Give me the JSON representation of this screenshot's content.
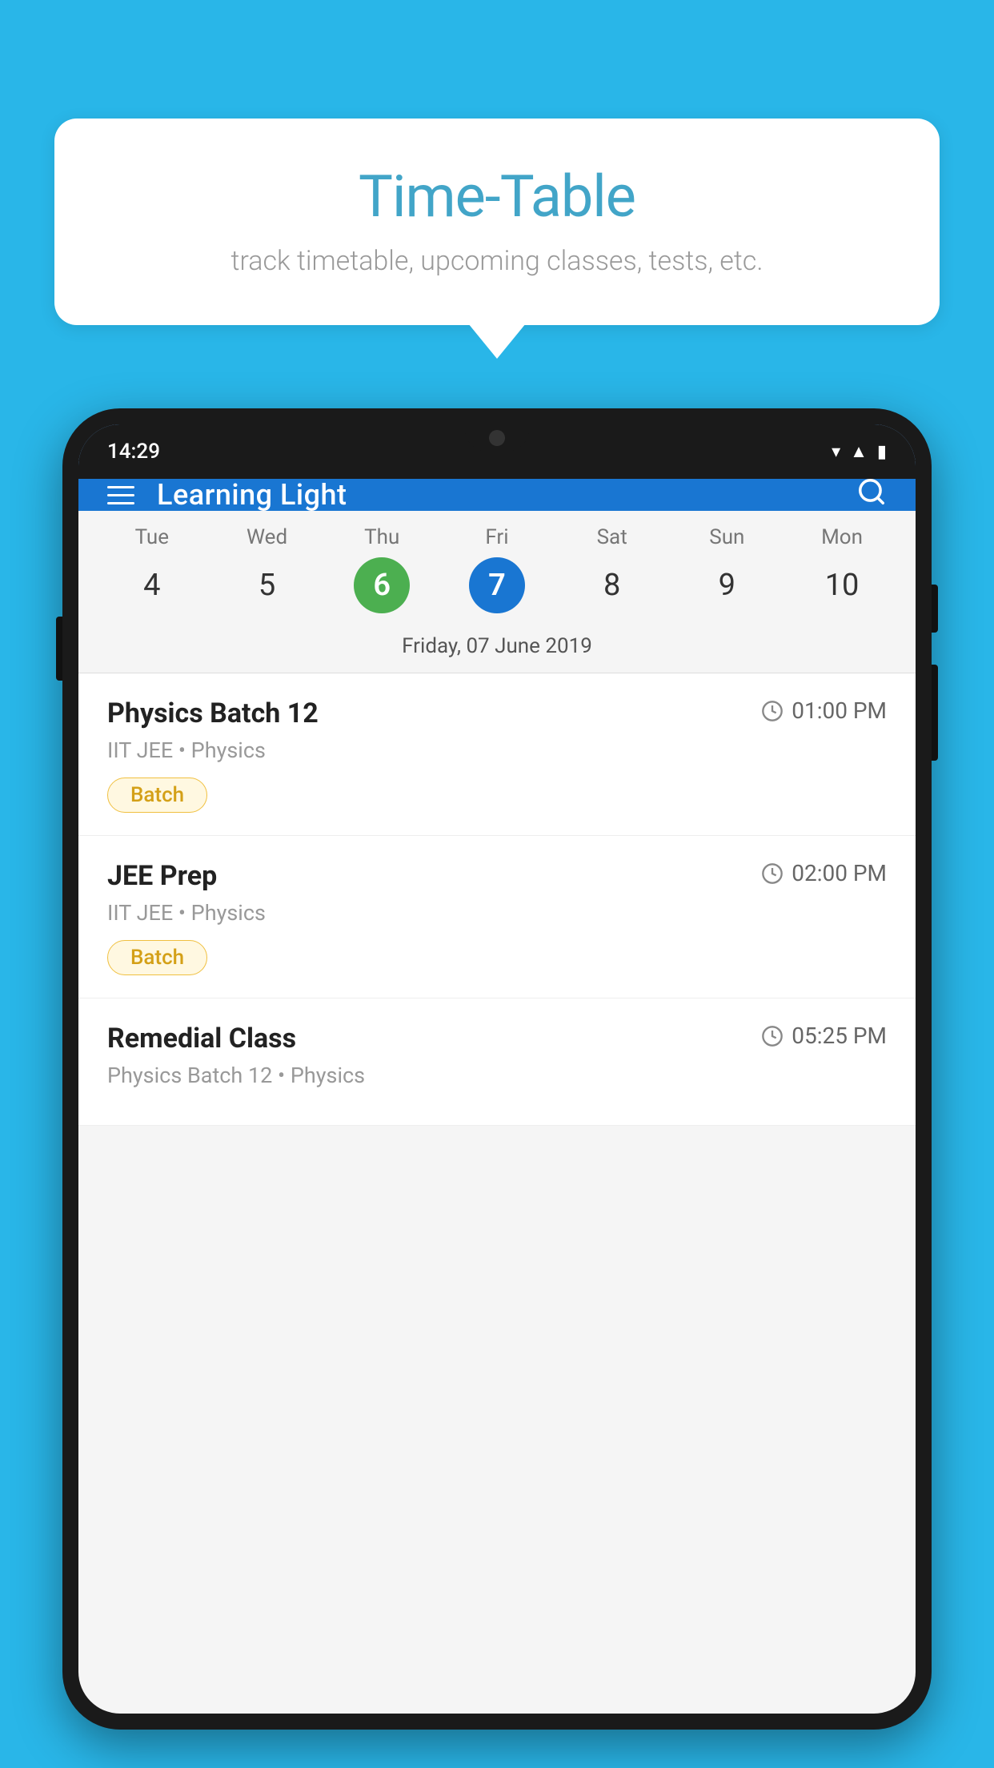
{
  "background_color": "#29b6e8",
  "speech_bubble": {
    "title": "Time-Table",
    "subtitle": "track timetable, upcoming classes, tests, etc."
  },
  "phone": {
    "status_bar": {
      "time": "14:29",
      "icons": [
        "wifi",
        "signal",
        "battery"
      ]
    },
    "app_bar": {
      "title": "Learning Light",
      "search_label": "search"
    },
    "calendar": {
      "days": [
        {
          "label": "Tue",
          "number": "4",
          "state": "normal"
        },
        {
          "label": "Wed",
          "number": "5",
          "state": "normal"
        },
        {
          "label": "Thu",
          "number": "6",
          "state": "today"
        },
        {
          "label": "Fri",
          "number": "7",
          "state": "selected"
        },
        {
          "label": "Sat",
          "number": "8",
          "state": "normal"
        },
        {
          "label": "Sun",
          "number": "9",
          "state": "normal"
        },
        {
          "label": "Mon",
          "number": "10",
          "state": "normal"
        }
      ],
      "selected_date_label": "Friday, 07 June 2019"
    },
    "classes": [
      {
        "name": "Physics Batch 12",
        "time": "01:00 PM",
        "meta": "IIT JEE • Physics",
        "tag": "Batch"
      },
      {
        "name": "JEE Prep",
        "time": "02:00 PM",
        "meta": "IIT JEE • Physics",
        "tag": "Batch"
      },
      {
        "name": "Remedial Class",
        "time": "05:25 PM",
        "meta": "Physics Batch 12 • Physics",
        "tag": ""
      }
    ]
  }
}
